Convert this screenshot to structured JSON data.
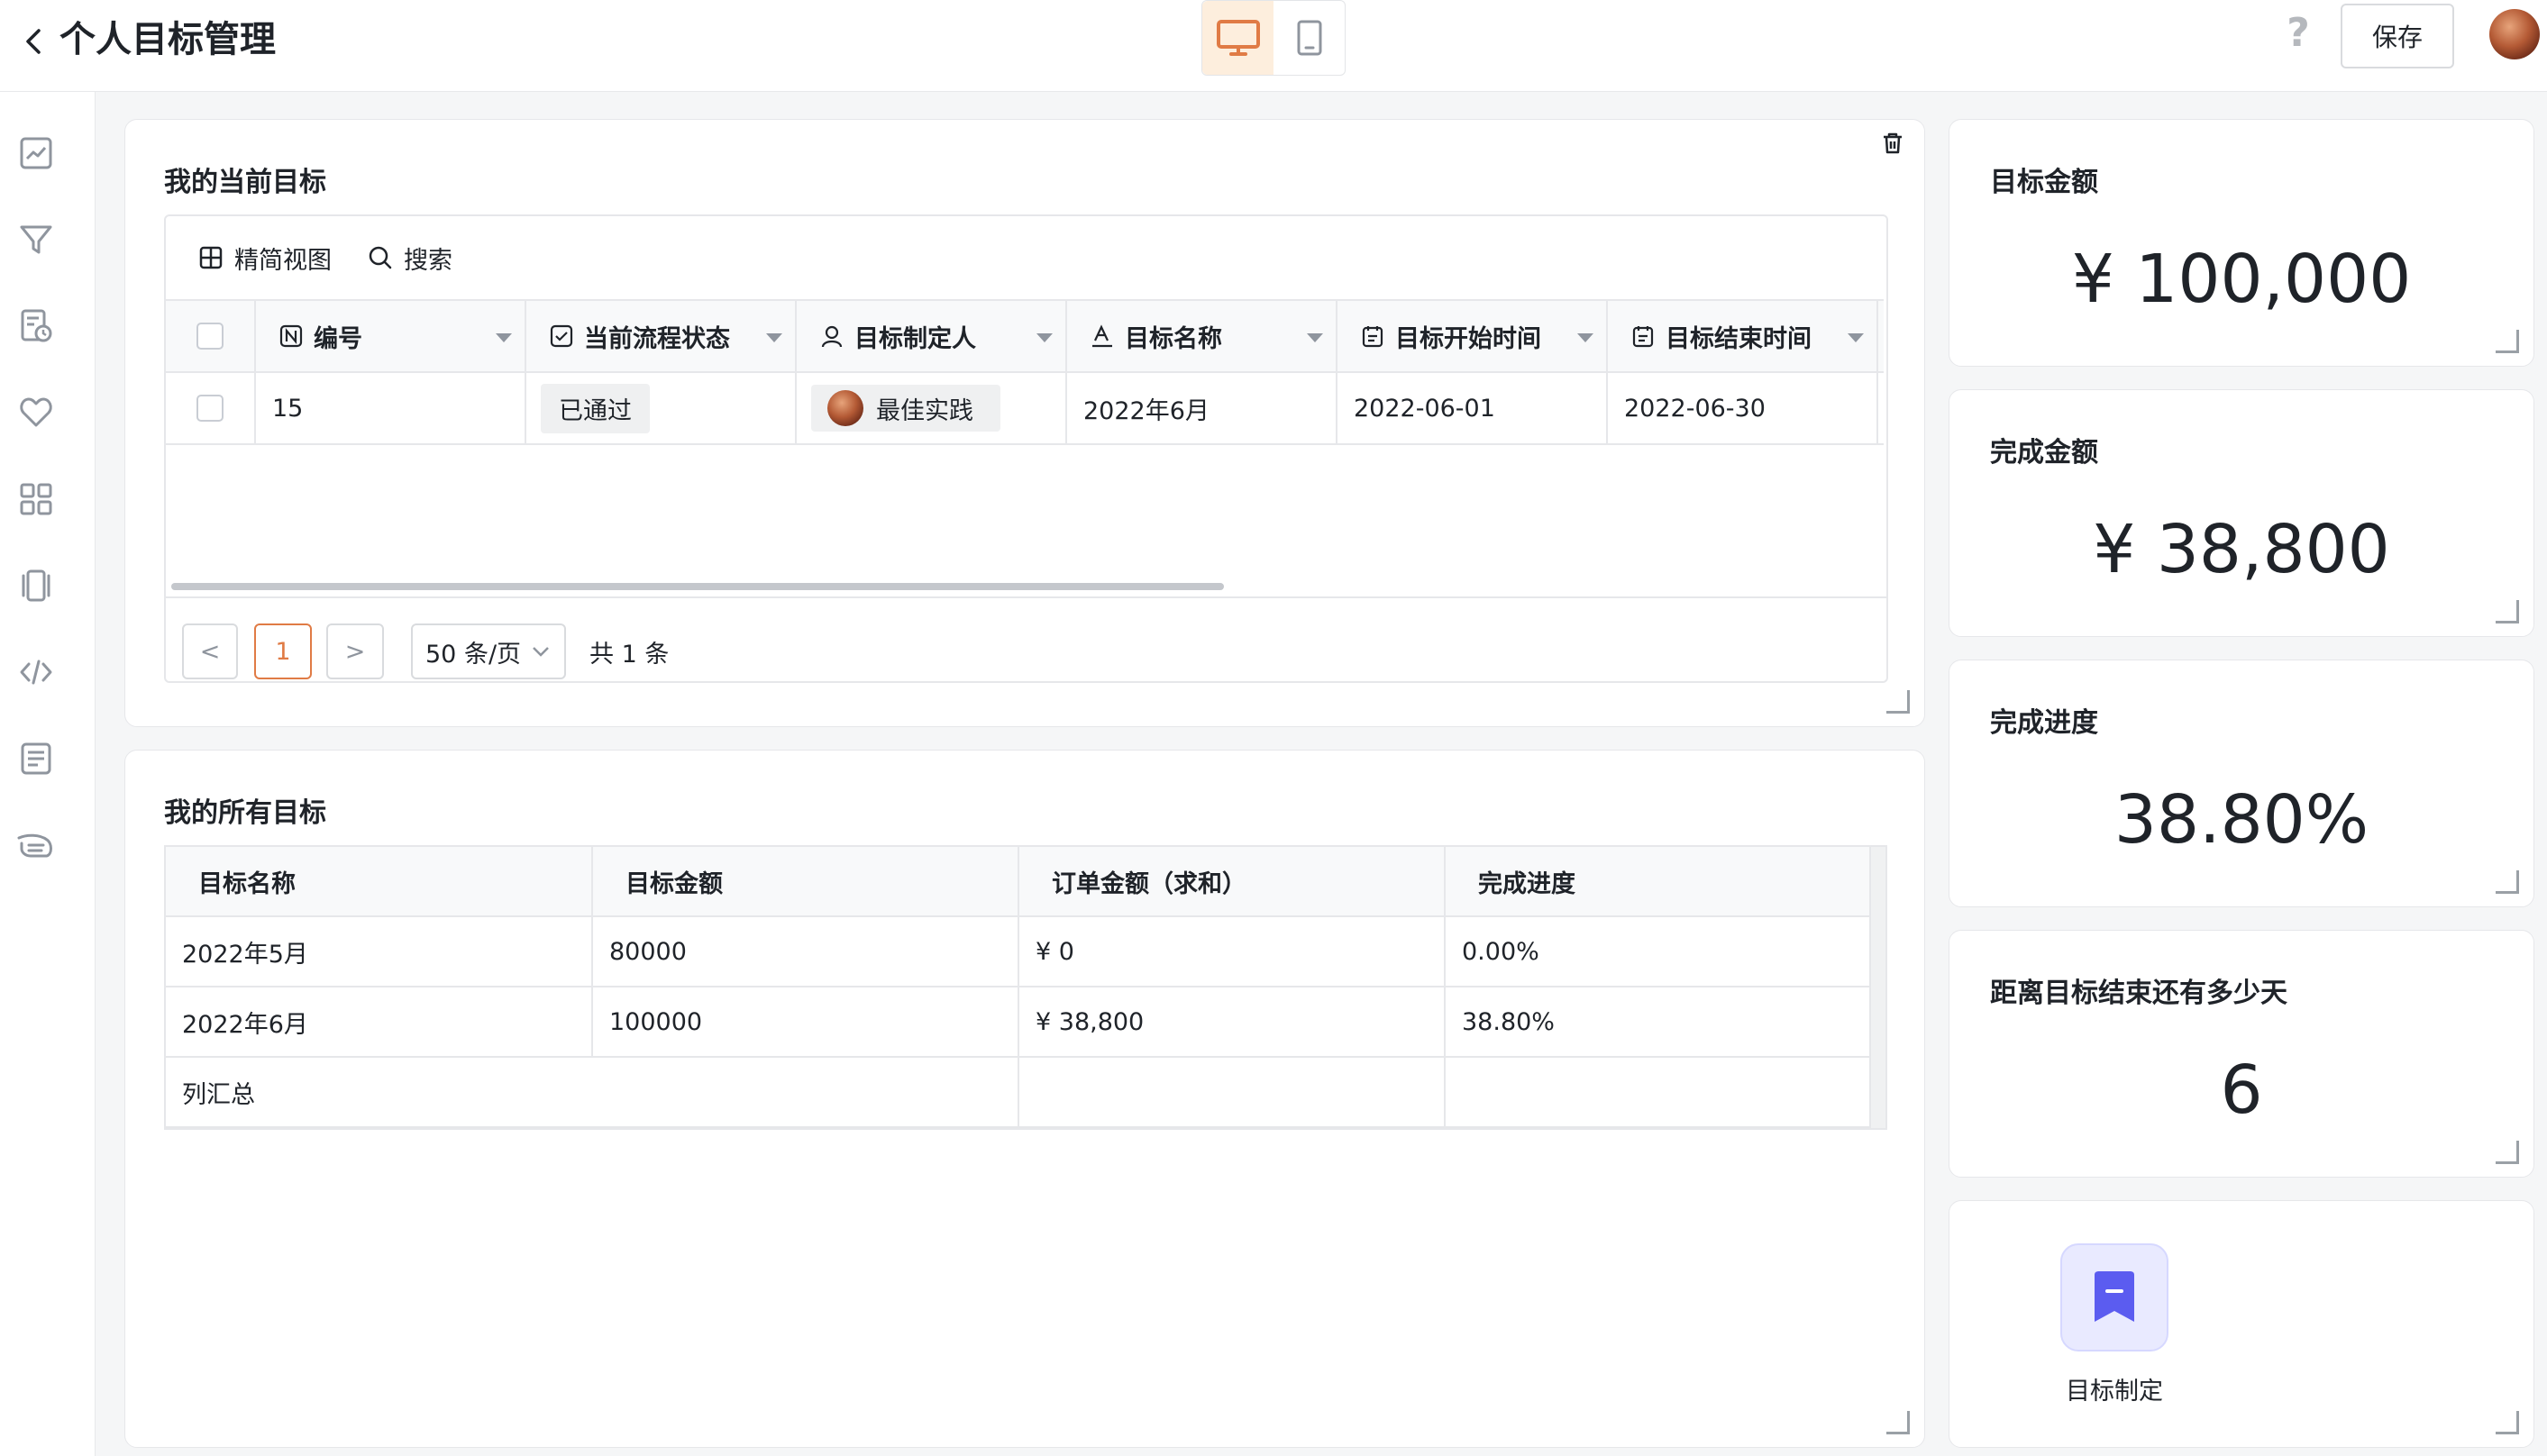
{
  "header": {
    "title": "个人目标管理",
    "save_label": "保存",
    "help_label": "?"
  },
  "sidebar": {
    "icons": [
      "chart-icon",
      "filter-icon",
      "doc-clock-icon",
      "heart-icon",
      "grid-icon",
      "carousel-icon",
      "code-icon",
      "document-icon",
      "hand-icon"
    ]
  },
  "current_goal": {
    "title": "我的当前目标",
    "toolbar": {
      "view_label": "精简视图",
      "search_label": "搜索"
    },
    "columns": [
      "编号",
      "当前流程状态",
      "目标制定人",
      "目标名称",
      "目标开始时间",
      "目标结束时间"
    ],
    "row": {
      "id": "15",
      "status": "已通过",
      "owner": "最佳实践",
      "name": "2022年6月",
      "start": "2022-06-01",
      "end": "2022-06-30"
    },
    "pagination": {
      "prev": "<",
      "current_page": "1",
      "next": ">",
      "page_size": "50 条/页",
      "total": "共 1 条"
    }
  },
  "all_goals": {
    "title": "我的所有目标",
    "columns": [
      "目标名称",
      "目标金额",
      "订单金额（求和）",
      "完成进度"
    ],
    "rows": [
      [
        "2022年5月",
        "80000",
        "¥ 0",
        "0.00%"
      ],
      [
        "2022年6月",
        "100000",
        "¥ 38,800",
        "38.80%"
      ]
    ],
    "summary_label": "列汇总"
  },
  "kpis": {
    "target_amount": {
      "title": "目标金额",
      "value": "¥ 100,000"
    },
    "completed_amount": {
      "title": "完成金额",
      "value": "¥ 38,800"
    },
    "progress": {
      "title": "完成进度",
      "value": "38.80%"
    },
    "days_left": {
      "title": "距离目标结束还有多少天",
      "value": "6"
    }
  },
  "launcher": {
    "label": "目标制定"
  },
  "colors": {
    "accent": "#e07b45",
    "launcher_bg": "#e9eaff",
    "launcher_icon": "#5b5cf0"
  }
}
